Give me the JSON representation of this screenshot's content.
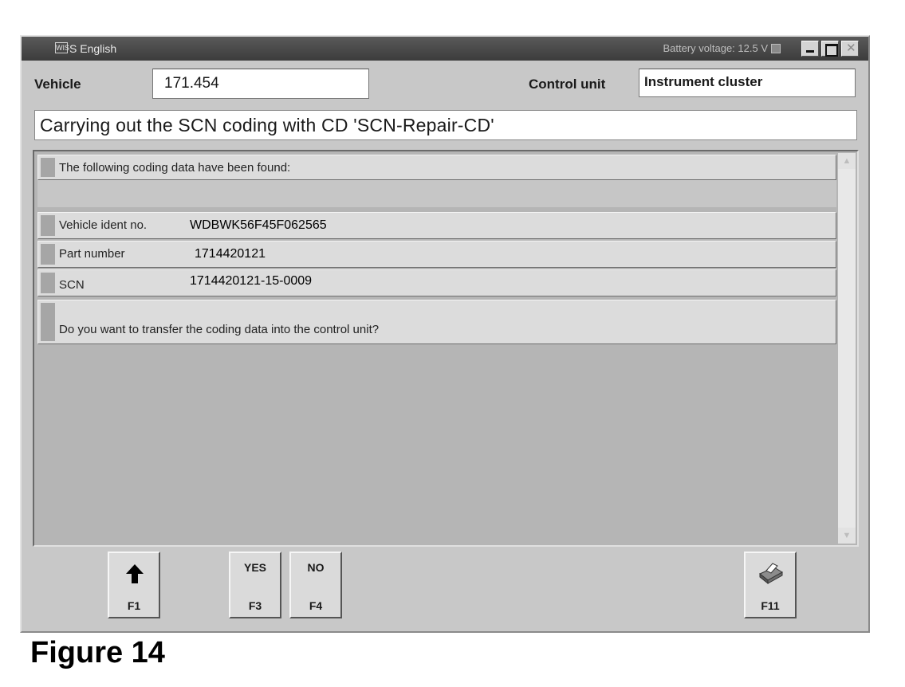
{
  "window": {
    "title": "S English",
    "app_icon_glyph": "WIS",
    "battery_label": "Battery voltage: 12.5 V",
    "controls": [
      "minimize",
      "maximize",
      "close"
    ]
  },
  "header": {
    "vehicle_label": "Vehicle",
    "vehicle_value": "171.454",
    "control_unit_label": "Control unit",
    "control_unit_value": "Instrument cluster"
  },
  "heading": "Carrying out the SCN coding with CD 'SCN-Repair-CD'",
  "rows": {
    "found_text": "The following coding data have been found:",
    "vin_label": "Vehicle ident no.",
    "vin_value": "WDBWK56F45F062565",
    "part_label": "Part number",
    "part_value": "1714420121",
    "scn_label": "SCN",
    "scn_value": "1714420121-15-0009",
    "question": "Do you want to transfer the coding data into the control unit?"
  },
  "function_keys": {
    "f1": {
      "icon": "up-arrow-icon",
      "key": "F1"
    },
    "f3": {
      "caption": "YES",
      "key": "F3"
    },
    "f4": {
      "caption": "NO",
      "key": "F4"
    },
    "f11": {
      "icon": "printer-icon",
      "key": "F11"
    }
  },
  "figure_caption": "Figure 14"
}
